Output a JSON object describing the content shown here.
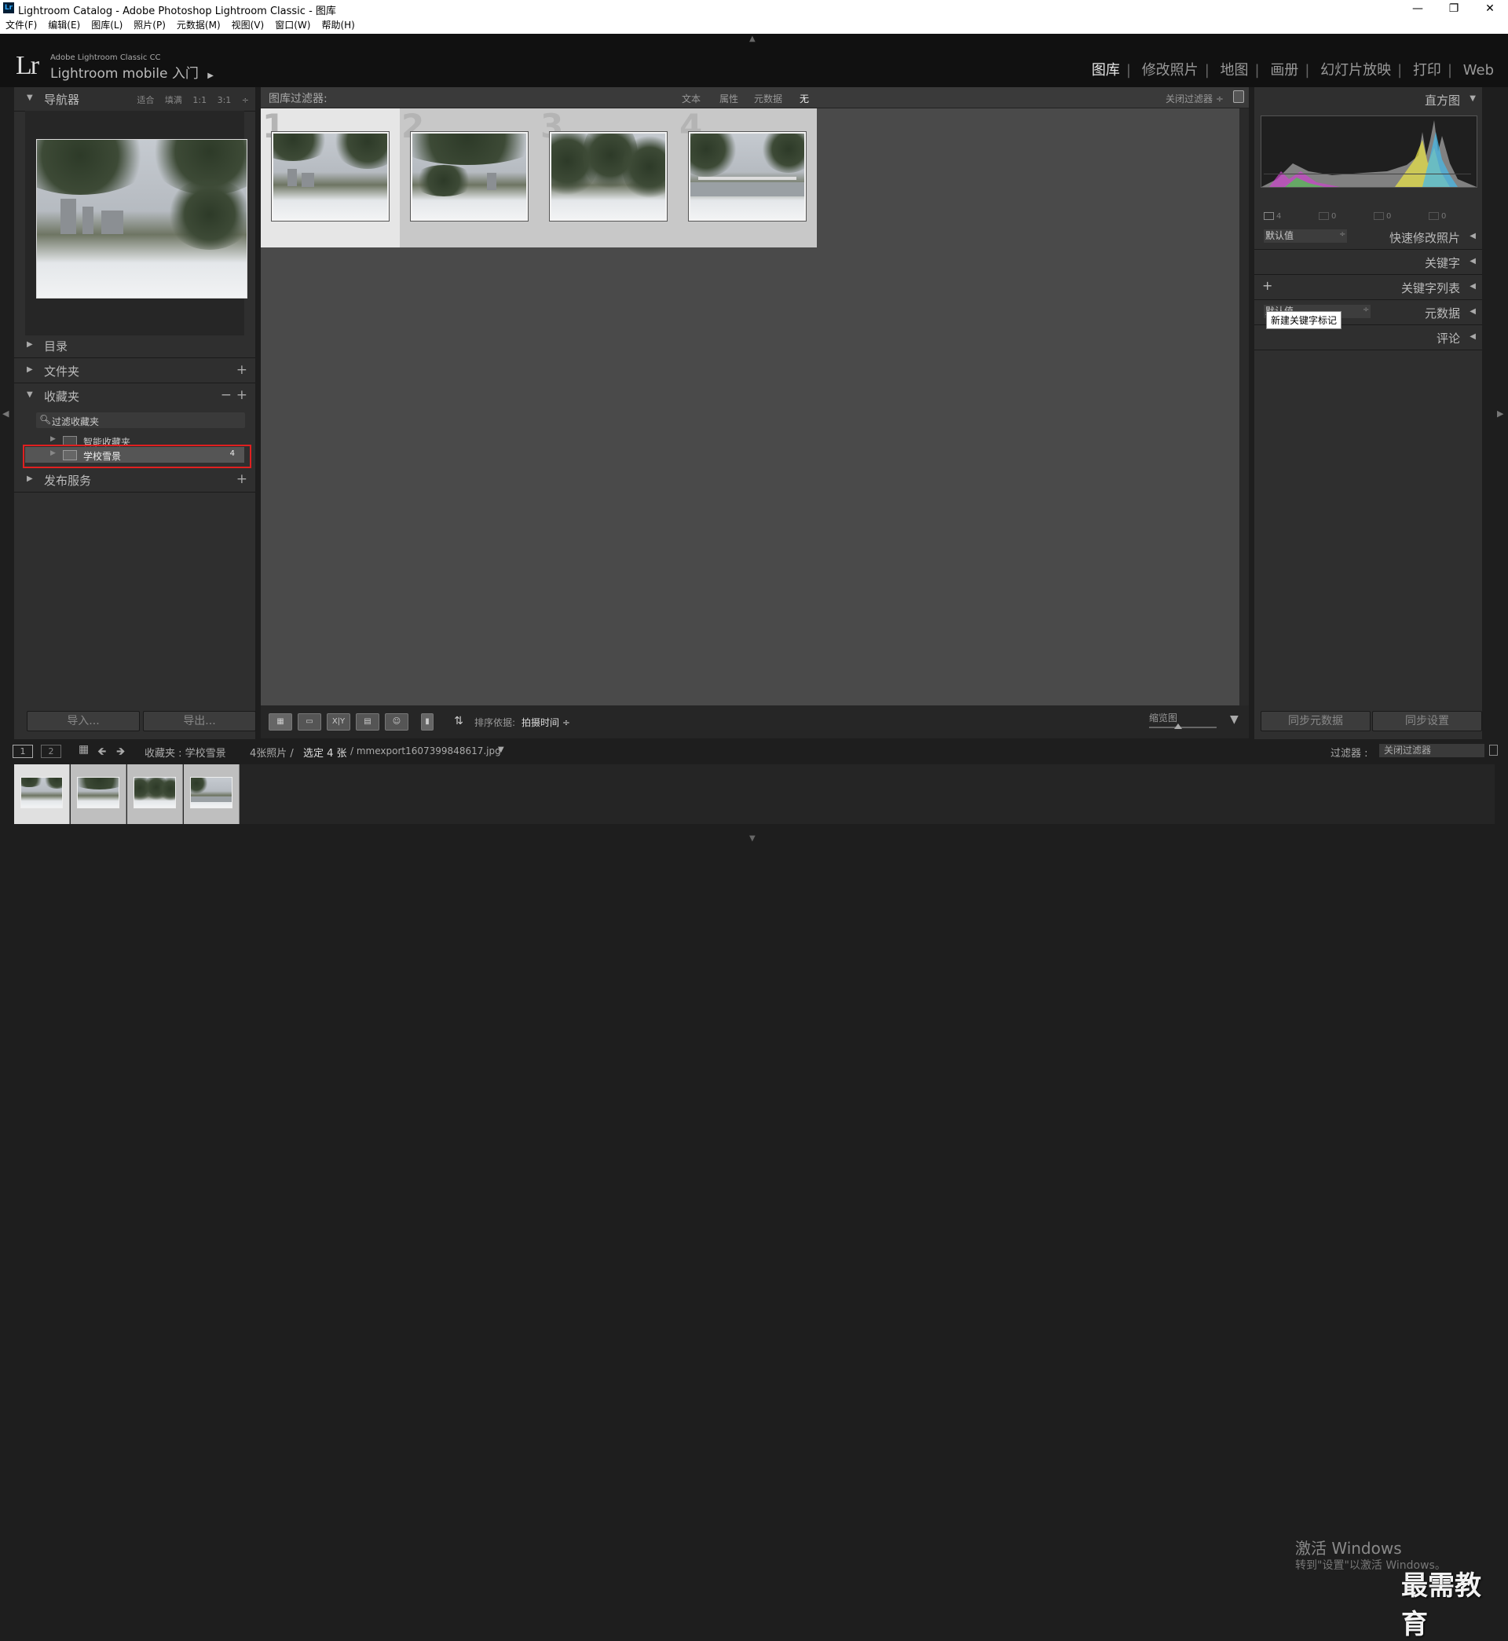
{
  "window": {
    "app_badge": "Lr",
    "title": "Lightroom Catalog - Adobe Photoshop Lightroom Classic - 图库",
    "controls": {
      "minimize": "—",
      "restore": "❐",
      "close": "✕"
    }
  },
  "menu": [
    "文件(F)",
    "编辑(E)",
    "图库(L)",
    "照片(P)",
    "元数据(M)",
    "视图(V)",
    "窗口(W)",
    "帮助(H)"
  ],
  "identity": {
    "logo": "Lr",
    "product": "Adobe Lightroom Classic CC",
    "mobile": "Lightroom mobile 入门",
    "play": "▶"
  },
  "modules": [
    {
      "label": "图库",
      "active": true
    },
    {
      "label": "修改照片"
    },
    {
      "label": "地图"
    },
    {
      "label": "画册"
    },
    {
      "label": "幻灯片放映"
    },
    {
      "label": "打印"
    },
    {
      "label": "Web"
    }
  ],
  "left_panel": {
    "navigator": {
      "title": "导航器",
      "options": [
        "适合",
        "填满",
        "1:1",
        "3:1"
      ]
    },
    "catalog": {
      "title": "目录"
    },
    "folders": {
      "title": "文件夹",
      "plus": "+"
    },
    "collections": {
      "title": "收藏夹",
      "minus": "−",
      "plus": "+",
      "filter": "过滤收藏夹",
      "items": [
        {
          "label": "智能收藏夹",
          "count": ""
        },
        {
          "label": "学校雪景",
          "count": "4",
          "selected": true
        }
      ]
    },
    "publish": {
      "title": "发布服务",
      "plus": "+"
    },
    "import_btn": "导入...",
    "export_btn": "导出..."
  },
  "filter_bar": {
    "label": "图库过滤器:",
    "options": [
      "文本",
      "属性",
      "元数据",
      "无"
    ],
    "active_option": "无",
    "close_filter": "关闭过滤器 ÷"
  },
  "grid": {
    "cells": [
      {
        "number": "1",
        "selected": true
      },
      {
        "number": "2"
      },
      {
        "number": "3"
      },
      {
        "number": "4"
      }
    ]
  },
  "toolbar": {
    "sort_label": "排序依据:",
    "sort_value": "拍摄时间 ÷",
    "thumb_label": "缩览图",
    "survey_label": "X|Y"
  },
  "right_panel": {
    "histogram": {
      "title": "直方图",
      "counts": [
        "4",
        "0",
        "0",
        "0"
      ]
    },
    "quick_develop": {
      "title": "快速修改照片",
      "preset": "默认值"
    },
    "keywording": {
      "title": "关键字"
    },
    "keyword_list": {
      "title": "关键字列表",
      "plus": "+"
    },
    "metadata": {
      "title": "元数据",
      "preset": "默认值"
    },
    "comments": {
      "title": "评论"
    },
    "tooltip": "新建关键字标记",
    "sync_metadata": "同步元数据",
    "sync_settings": "同步设置"
  },
  "filmstrip_bar": {
    "screen1": "1",
    "screen2": "2",
    "source": "收藏夹 : 学校雪景",
    "count": "4张照片 /",
    "selected": "选定 4 张",
    "filename": "/ mmexport1607399848617.jpg",
    "filter_label": "过滤器 :",
    "filter_value": "关闭过滤器"
  },
  "watermark": {
    "activate": "激活 Windows",
    "hint": "转到\"设置\"以激活 Windows。",
    "site_logo": "最需教育"
  }
}
